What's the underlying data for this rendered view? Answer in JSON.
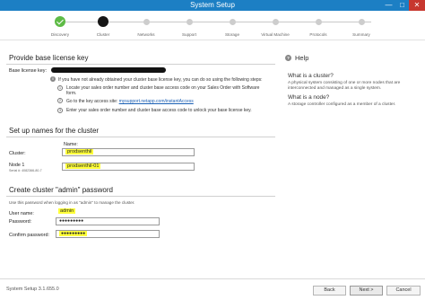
{
  "window": {
    "title": "System Setup",
    "min_glyph": "—",
    "max_glyph": "□",
    "close_glyph": "✕"
  },
  "steps": [
    {
      "label": "Discovery",
      "state": "done"
    },
    {
      "label": "Cluster",
      "state": "current"
    },
    {
      "label": "Networks",
      "state": "pending"
    },
    {
      "label": "Support",
      "state": "pending"
    },
    {
      "label": "Storage",
      "state": "pending"
    },
    {
      "label": "Virtual Machine",
      "state": "pending"
    },
    {
      "label": "Protocols",
      "state": "pending"
    },
    {
      "label": "Summary",
      "state": "pending"
    }
  ],
  "license": {
    "heading": "Provide base license key",
    "base_key_label": "Base license key:",
    "intro": "If you have not already obtained your cluster base license key, you can do so using the following steps:",
    "step1": "Locate your sales order number and cluster base access code on your Sales Order with Software form.",
    "step2_prefix": "Go to the key access site:",
    "step2_link": "mysupport.netapp.com/instantAccess",
    "step3": "Enter your sales order number and cluster base access code to unlock your base license key."
  },
  "names": {
    "heading": "Set up names for the cluster",
    "name_col": "Name:",
    "cluster_label": "Cluster:",
    "cluster_value": "prodsenthil",
    "node_label": "Node 1",
    "node_serial": "Serial #: 4082366-80-7",
    "node_value": "prodsenthil-01"
  },
  "admin": {
    "heading": "Create cluster \"admin\" password",
    "hint": "Use this password when logging in as \"admin\" to manage the cluster.",
    "user_label": "User name:",
    "user_value": "admin",
    "password_label": "Password:",
    "password_value": "●●●●●●●●●",
    "confirm_label": "Confirm password:",
    "confirm_value": "●●●●●●●●●"
  },
  "help": {
    "title": "Help",
    "q1": "What is a cluster?",
    "a1": "A physical system consisting of one or more nodes that are interconnected and managed as a single system.",
    "q2": "What is a node?",
    "a2": "A storage controller configured as a member of a cluster."
  },
  "footer": {
    "version": "System Setup 3.1.655.0",
    "back": "Back",
    "next": "Next >",
    "cancel": "Cancel"
  },
  "colors": {
    "titlebar": "#1c7fc4",
    "done": "#5ebb46",
    "highlight": "#ffff3a"
  }
}
